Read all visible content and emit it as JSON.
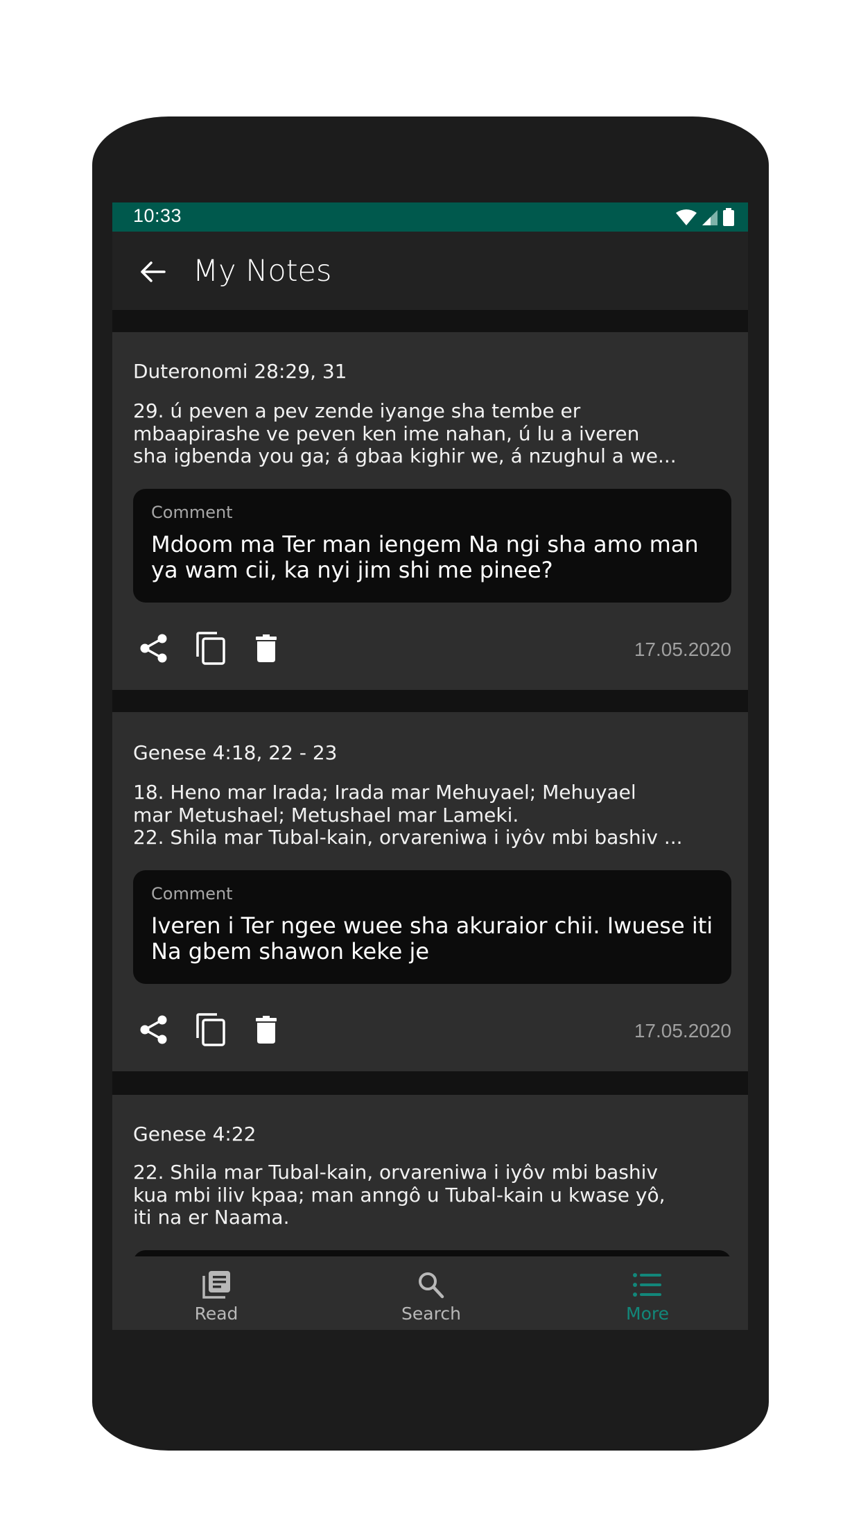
{
  "status_bar": {
    "time": "10:33",
    "icons": [
      "wifi-icon",
      "signal-icon",
      "battery-icon"
    ]
  },
  "app_bar": {
    "back_icon": "arrow-left-icon",
    "title": "My Notes"
  },
  "colors": {
    "status_bar": "#00594d",
    "accent": "#12877a",
    "app_bar": "#222222",
    "card": "#2e2e2e",
    "comment_box": "#0c0c0c",
    "separator": "#121212"
  },
  "notes": [
    {
      "reference": "Duteronomi 28:29, 31",
      "verse_text": "29.  ú peven a pev zende iyange sha tembe er\nmbaapirashe ve peven ken ime nahan, ú lu a iveren\nsha igbenda you ga; á gbaa kighir we, á nzughul a we...",
      "comment_label": "Comment",
      "comment_text": "Mdoom ma Ter man iengem Na ngi sha amo\nman ya wam cii, ka nyi jim shi me pinee?",
      "date": "17.05.2020",
      "actions": [
        "share-icon",
        "copy-icon",
        "delete-icon"
      ]
    },
    {
      "reference": "Genese 4:18, 22 - 23",
      "verse_text": "18.  Heno mar Irada; Irada mar Mehuyael; Mehuyael\nmar Metushael; Metushael mar Lameki.\n22. Shila mar Tubal-kain, orvareniwa i iyôv mbi bashiv ...",
      "comment_label": "Comment",
      "comment_text": "Iveren i Ter ngee wuee sha akuraior chii.\nIwuese iti Na gbem shawon keke je",
      "date": "17.05.2020",
      "actions": [
        "share-icon",
        "copy-icon",
        "delete-icon"
      ]
    },
    {
      "reference": "Genese 4:22",
      "verse_text": "22. Shila mar Tubal-kain, orvareniwa i iyôv mbi bashiv\nkua mbi iliv kpaa; man anngô u Tubal-kain u kwase yô,\niti na er Naama."
    }
  ],
  "bottom_nav": {
    "items": [
      {
        "label": "Read",
        "icon": "book-icon",
        "active": false
      },
      {
        "label": "Search",
        "icon": "search-icon",
        "active": false
      },
      {
        "label": "More",
        "icon": "list-icon",
        "active": true
      }
    ]
  }
}
